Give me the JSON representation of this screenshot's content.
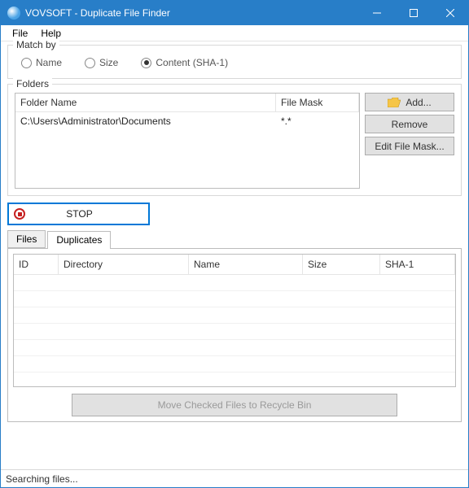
{
  "window": {
    "title": "VOVSOFT - Duplicate File Finder"
  },
  "menu": {
    "file": "File",
    "help": "Help"
  },
  "match": {
    "legend": "Match by",
    "options": {
      "name": "Name",
      "size": "Size",
      "content": "Content (SHA-1)"
    },
    "selected": "content"
  },
  "folders": {
    "legend": "Folders",
    "columns": {
      "name": "Folder Name",
      "mask": "File Mask"
    },
    "rows": [
      {
        "name": "C:\\Users\\Administrator\\Documents",
        "mask": "*.*"
      }
    ],
    "buttons": {
      "add": "Add...",
      "remove": "Remove",
      "editmask": "Edit File Mask..."
    }
  },
  "actions": {
    "stop": "STOP"
  },
  "tabs": {
    "files": "Files",
    "duplicates": "Duplicates",
    "active": "duplicates"
  },
  "grid": {
    "columns": {
      "id": "ID",
      "directory": "Directory",
      "name": "Name",
      "size": "Size",
      "sha1": "SHA-1"
    }
  },
  "recycle": {
    "label": "Move Checked Files to Recycle Bin",
    "enabled": false
  },
  "status": "Searching files..."
}
